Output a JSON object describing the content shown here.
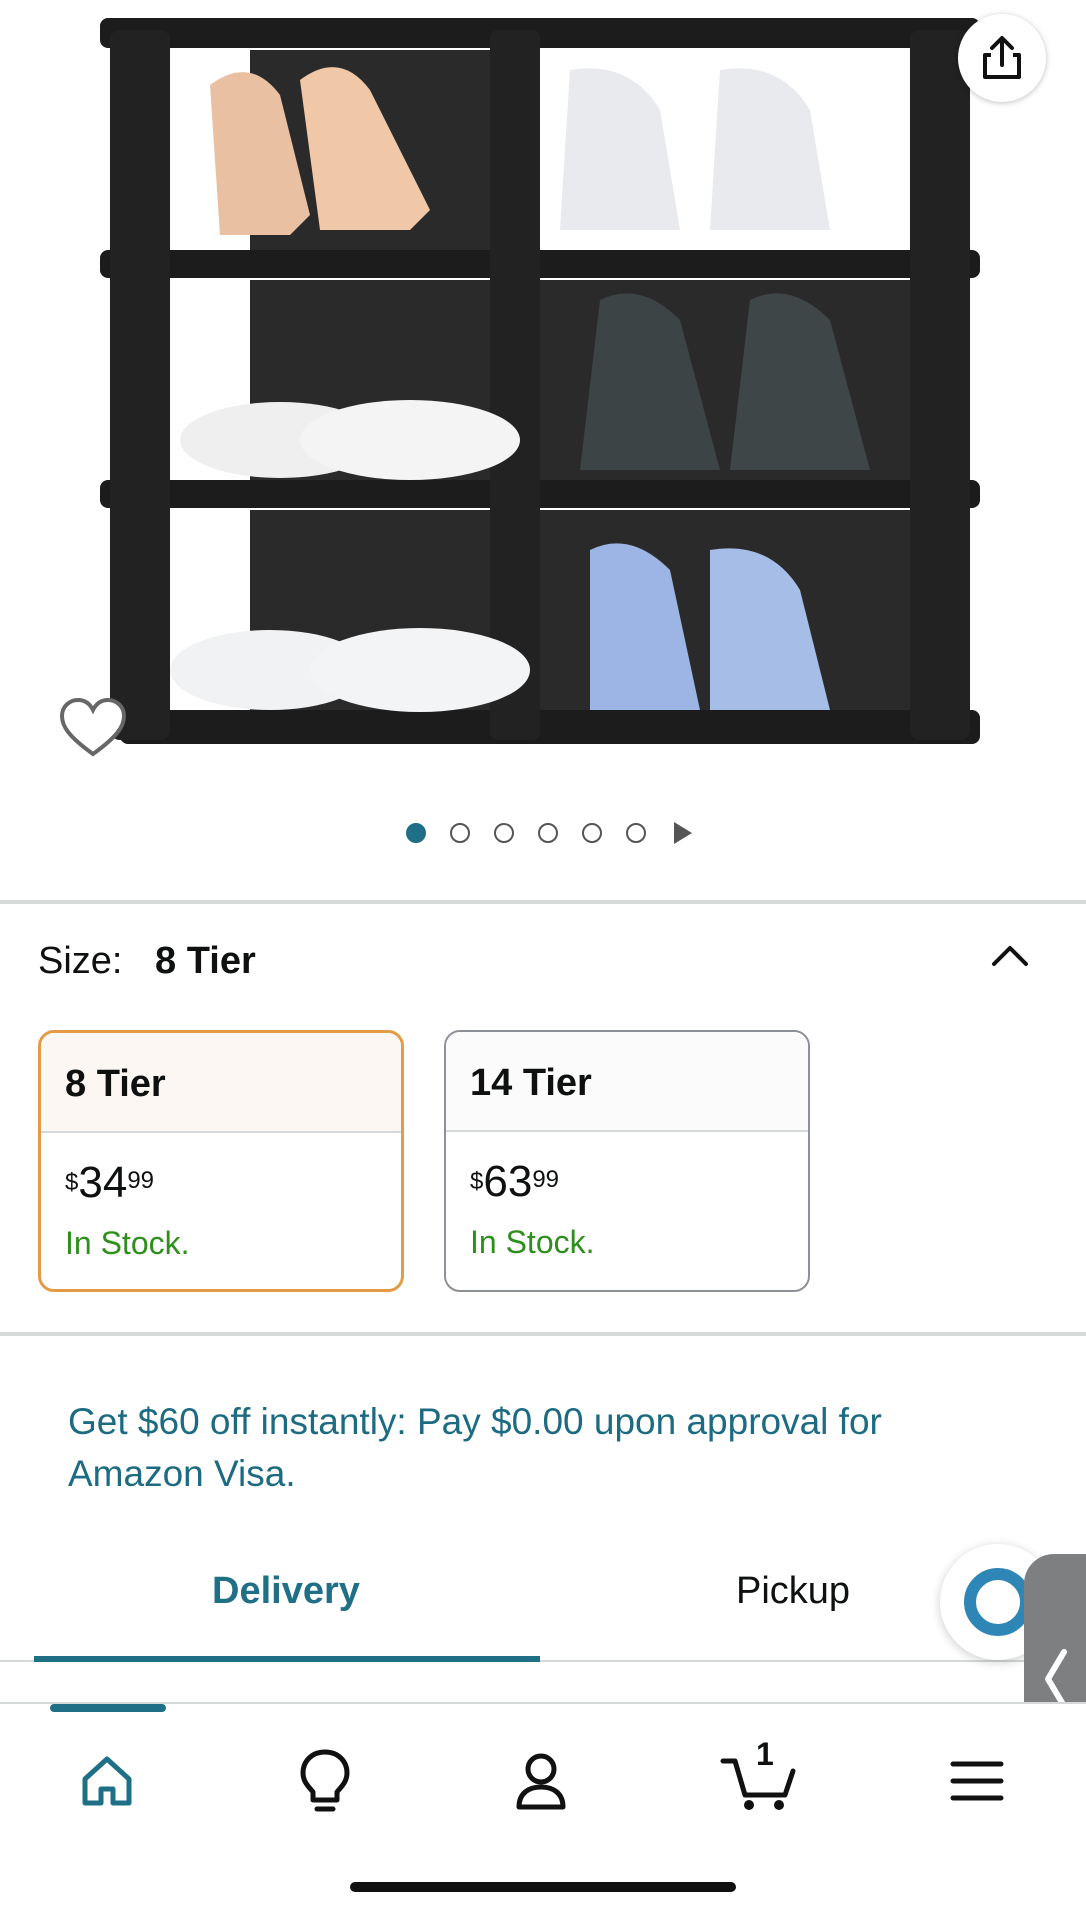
{
  "product": {
    "image_alt": "Black 8 tier shoe rack holding heels, sneakers, flats, high-tops, slides and basketball shoes"
  },
  "gallery": {
    "total_images": 6,
    "active_index": 1
  },
  "size": {
    "label": "Size:",
    "selected": "8 Tier",
    "options": [
      {
        "name": "8 Tier",
        "currency": "$",
        "dollars": "34",
        "cents": "99",
        "stock": "In Stock."
      },
      {
        "name": "14 Tier",
        "currency": "$",
        "dollars": "63",
        "cents": "99",
        "stock": "In Stock."
      }
    ]
  },
  "promo": {
    "text": "Get $60 off instantly: Pay $0.00 upon approval for Amazon Visa."
  },
  "tabs": {
    "delivery": "Delivery",
    "pickup": "Pickup"
  },
  "bottom_nav": {
    "cart_count": "1"
  },
  "colors": {
    "accent": "#1f6f86",
    "selected_border": "#e39b45",
    "in_stock": "#2e8f1d"
  }
}
